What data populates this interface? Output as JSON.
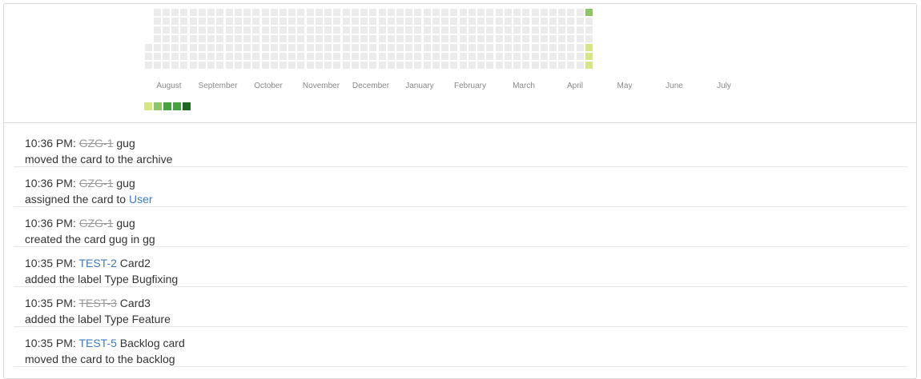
{
  "colors": {
    "empty": "#ebebeb",
    "level1": "#d6e685",
    "level2": "#8cc665",
    "level3": "#44a340",
    "level4": "#1e6823",
    "link": "#3a7bbf",
    "archived": "#999999"
  },
  "heatmap": {
    "months": [
      "August",
      "September",
      "October",
      "November",
      "December",
      "January",
      "February",
      "March",
      "April",
      "May",
      "June",
      "July"
    ],
    "active_days": [
      {
        "week": 49,
        "day": 0,
        "level": 2
      },
      {
        "week": 49,
        "day": 4,
        "level": 1
      },
      {
        "week": 49,
        "day": 5,
        "level": 1
      },
      {
        "week": 49,
        "day": 6,
        "level": 1
      }
    ],
    "legend_levels": [
      "level1",
      "level2",
      "level3",
      "level3",
      "level4"
    ]
  },
  "activities": [
    {
      "time": "10:35 PM:",
      "key": "TEST-5",
      "archived": false,
      "title": "Backlog card",
      "action": "moved the card to the backlog",
      "user": ""
    },
    {
      "time": "10:35 PM:",
      "key": "TEST-3",
      "archived": true,
      "title": "Card3",
      "action": "added the label Type Feature",
      "user": ""
    },
    {
      "time": "10:35 PM:",
      "key": "TEST-2",
      "archived": false,
      "title": "Card2",
      "action": "added the label Type Bugfixing",
      "user": ""
    },
    {
      "time": "10:36 PM:",
      "key": "GZG-1",
      "archived": true,
      "title": "gug",
      "action": "created the card gug in gg",
      "user": ""
    },
    {
      "time": "10:36 PM:",
      "key": "GZG-1",
      "archived": true,
      "title": "gug",
      "action": "assigned the card to",
      "user": "User"
    },
    {
      "time": "10:36 PM:",
      "key": "GZG-1",
      "archived": true,
      "title": "gug",
      "action": "moved the card to the archive",
      "user": ""
    }
  ]
}
